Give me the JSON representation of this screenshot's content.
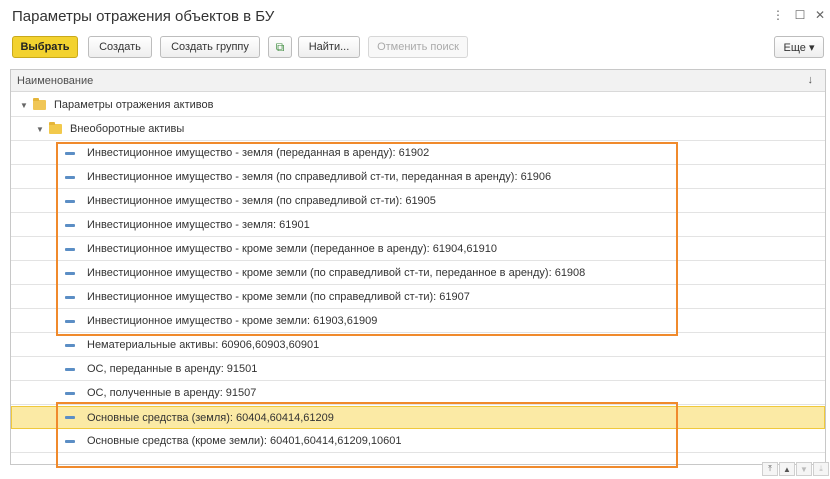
{
  "window": {
    "title": "Параметры отражения объектов в БУ",
    "more_glyph": "⋮",
    "restore_glyph": "☐",
    "close_glyph": "✕"
  },
  "toolbar": {
    "select_label": "Выбрать",
    "create_label": "Создать",
    "create_group_label": "Создать группу",
    "find_label": "Найти...",
    "cancel_search_label": "Отменить поиск",
    "more_label": "Еще ▾",
    "copy_glyph": "⧉"
  },
  "table": {
    "header": "Наименование",
    "sort_glyph": "↓",
    "rows": [
      {
        "label": "Параметры отражения активов",
        "type": "group"
      },
      {
        "label": "Внеоборотные активы",
        "type": "group"
      },
      {
        "label": "Инвестиционное имущество - земля (переданная в аренду): 61902",
        "type": "item"
      },
      {
        "label": "Инвестиционное имущество - земля (по справедливой ст-ти, переданная в аренду): 61906",
        "type": "item"
      },
      {
        "label": "Инвестиционное имущество - земля (по справедливой ст-ти): 61905",
        "type": "item"
      },
      {
        "label": "Инвестиционное имущество - земля: 61901",
        "type": "item"
      },
      {
        "label": "Инвестиционное имущество - кроме земли (переданное в аренду): 61904,61910",
        "type": "item"
      },
      {
        "label": "Инвестиционное имущество - кроме земли (по справедливой ст-ти, переданное в аренду): 61908",
        "type": "item"
      },
      {
        "label": "Инвестиционное имущество - кроме земли (по справедливой ст-ти): 61907",
        "type": "item"
      },
      {
        "label": "Инвестиционное имущество - кроме земли: 61903,61909",
        "type": "item"
      },
      {
        "label": "Нематериальные активы: 60906,60903,60901",
        "type": "item"
      },
      {
        "label": "ОС, переданные в аренду: 91501",
        "type": "item"
      },
      {
        "label": "ОС, полученные в аренду: 91507",
        "type": "item"
      },
      {
        "label": "Основные средства (земля): 60404,60414,61209",
        "type": "item",
        "selected": true
      },
      {
        "label": "Основные средства (кроме земли): 60401,60414,61209,10601",
        "type": "item"
      }
    ]
  },
  "scroll": {
    "top_glyph": "⤒",
    "up_glyph": "▲",
    "down_glyph": "▼",
    "bottom_glyph": "⤓"
  },
  "colors": {
    "primary_button": "#f3d22f",
    "selected_row": "#fbeaa5",
    "highlight_box": "#f08a2c",
    "folder": "#f2c94c",
    "item_marker": "#5b8ec5"
  }
}
